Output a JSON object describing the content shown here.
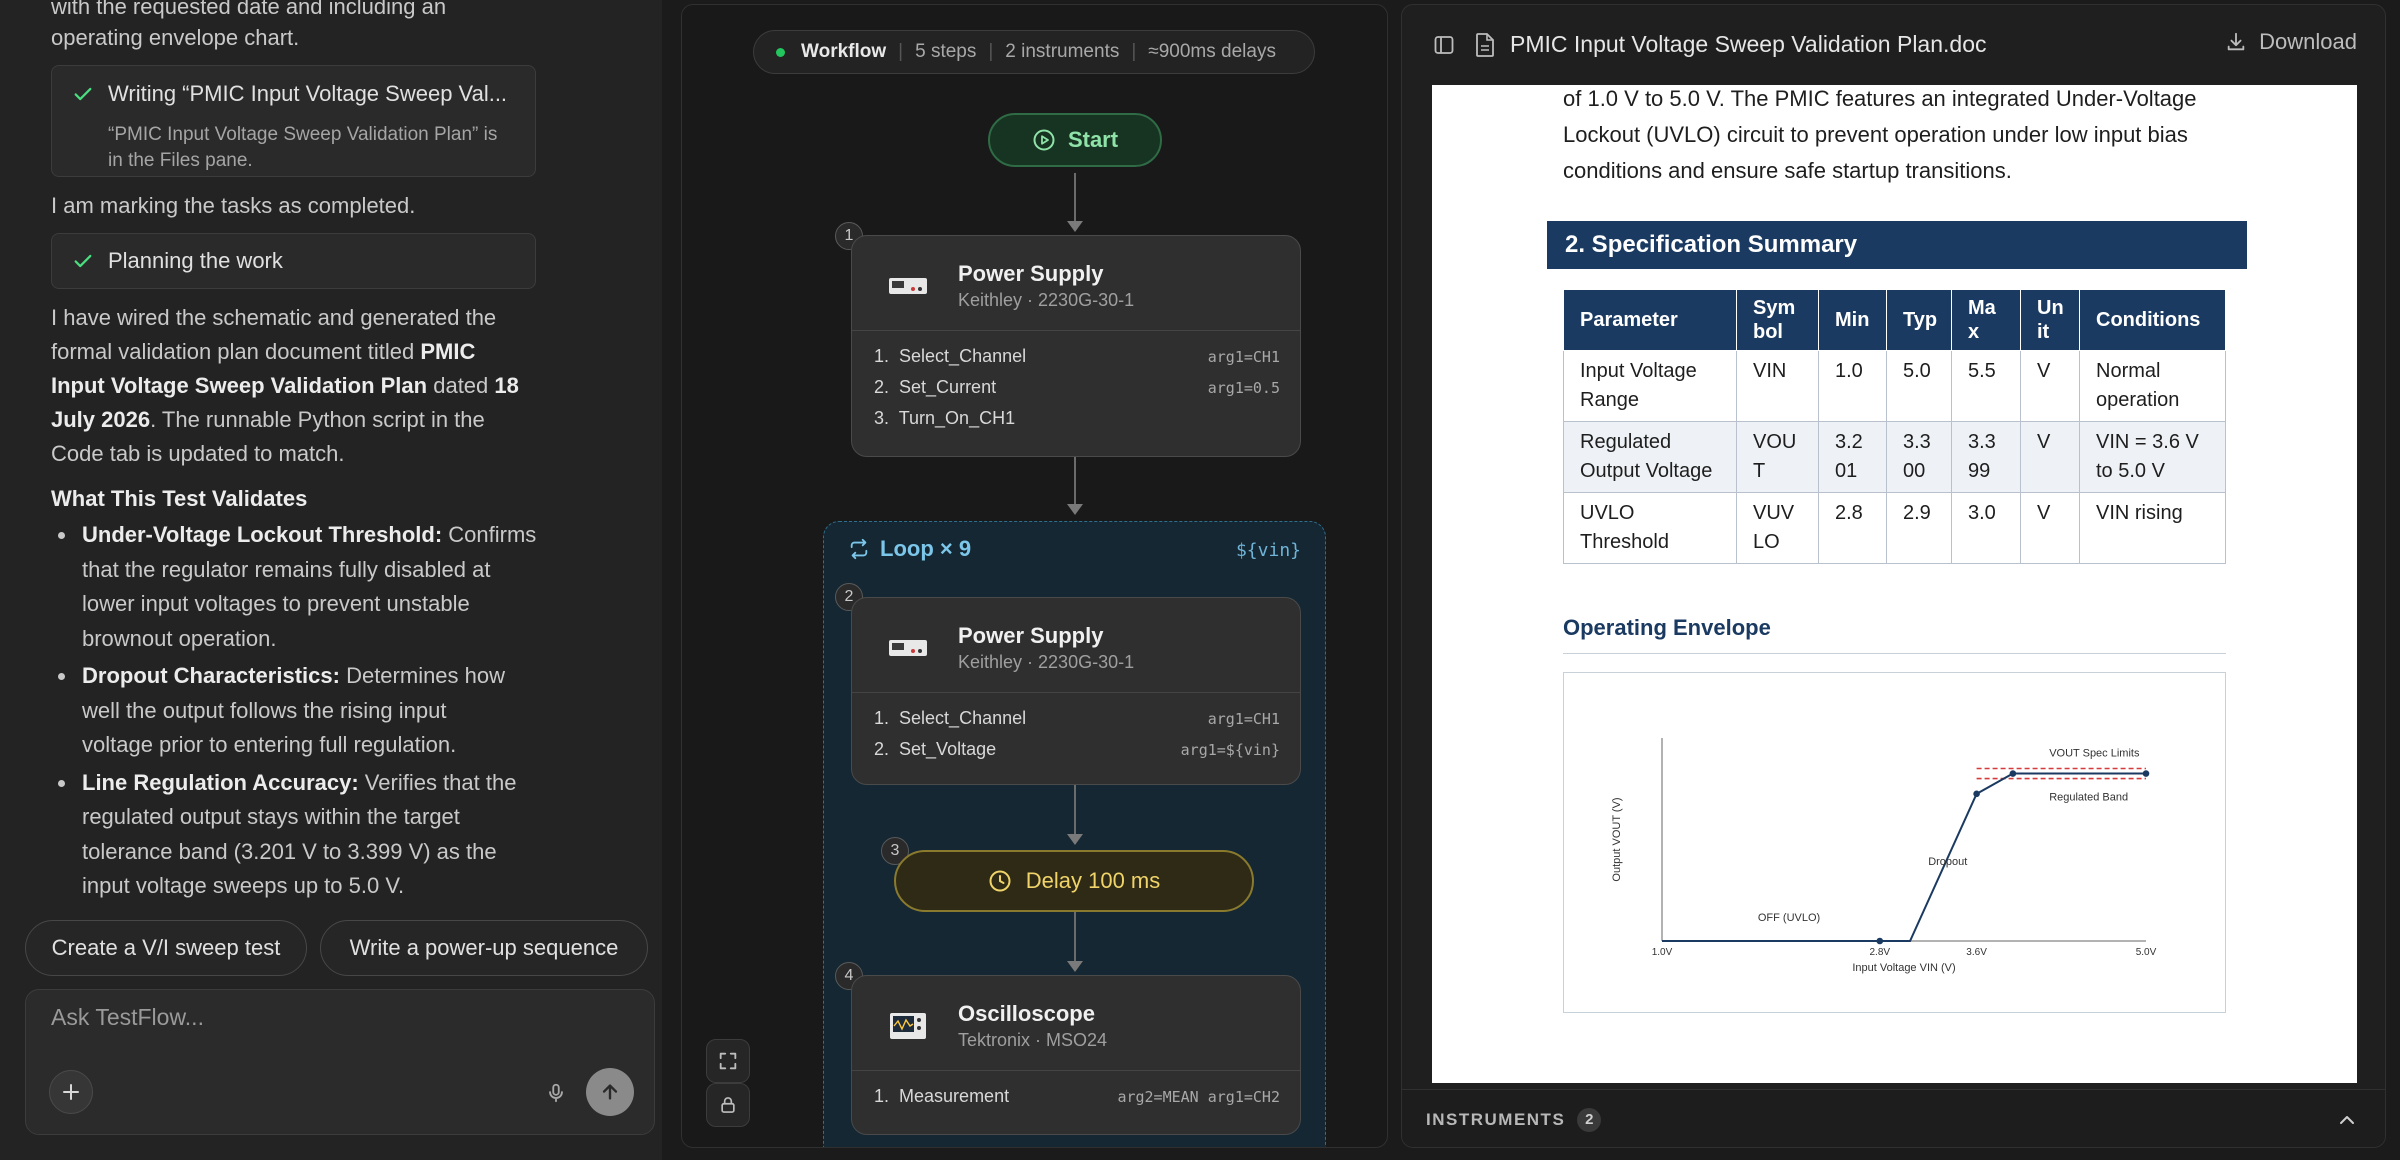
{
  "chat": {
    "intro_line1": "with the requested date and including an",
    "intro_line2": "operating envelope chart.",
    "task_writing": {
      "title": "Writing “PMIC Input Voltage Sweep Val...",
      "sub1": "“PMIC Input Voltage Sweep Validation Plan” is",
      "sub2": "in the Files pane."
    },
    "marking_text": "I am marking the tasks as completed.",
    "task_planning": {
      "title": "Planning the work"
    },
    "para": {
      "l1": "I have wired the schematic and generated the",
      "l2a": "formal validation plan document titled ",
      "l2b": "PMIC",
      "l3a": "Input Voltage Sweep Validation Plan",
      "l3b": " dated ",
      "l3c": "18",
      "l4a": "July 2026",
      "l4b": ". The runnable Python script in the",
      "l5": "Code tab is updated to match."
    },
    "validates_heading": "What This Test Validates",
    "bullets": [
      {
        "bold": "Under-Voltage Lockout Threshold:",
        "l1": " Confirms",
        "l2": "that the regulator remains fully disabled at",
        "l3": "lower input voltages to prevent unstable",
        "l4": "brownout operation."
      },
      {
        "bold": "Dropout Characteristics:",
        "l1": " Determines how",
        "l2": "well the output follows the rising input",
        "l3": "voltage prior to entering full regulation."
      },
      {
        "bold": "Line Regulation Accuracy:",
        "l1": " Verifies that the",
        "l2": "regulated output stays within the target",
        "l3": "tolerance band (3.201 V to 3.399 V) as the",
        "l4": "input voltage sweeps up to 5.0 V."
      }
    ],
    "suggestions": [
      "Create a V/I sweep test",
      "Write a power-up sequence"
    ],
    "composer_placeholder": "Ask TestFlow..."
  },
  "workflow": {
    "bar": {
      "label": "Workflow",
      "steps": "5 steps",
      "instruments": "2 instruments",
      "delays": "≈900ms delays"
    },
    "start_label": "Start",
    "node1": {
      "badge": "1",
      "title": "Power Supply",
      "subtitle": "Keithley · 2230G-30-1",
      "steps": [
        {
          "n": "1.",
          "name": "Select_Channel",
          "arg": "arg1=CH1"
        },
        {
          "n": "2.",
          "name": "Set_Current",
          "arg": "arg1=0.5"
        },
        {
          "n": "3.",
          "name": "Turn_On_CH1",
          "arg": ""
        }
      ]
    },
    "loop": {
      "label": "Loop × 9",
      "var": "${vin}"
    },
    "node2": {
      "badge": "2",
      "title": "Power Supply",
      "subtitle": "Keithley · 2230G-30-1",
      "steps": [
        {
          "n": "1.",
          "name": "Select_Channel",
          "arg": "arg1=CH1"
        },
        {
          "n": "2.",
          "name": "Set_Voltage",
          "arg": "arg1=${vin}"
        }
      ]
    },
    "delay": {
      "badge": "3",
      "label": "Delay 100 ms"
    },
    "node4": {
      "badge": "4",
      "title": "Oscilloscope",
      "subtitle": "Tektronix · MSO24",
      "steps": [
        {
          "n": "1.",
          "name": "Measurement",
          "arg": "arg2=MEAN arg1=CH2"
        }
      ]
    }
  },
  "document": {
    "filename": "PMIC Input Voltage Sweep Validation Plan.doc",
    "download_label": "Download",
    "intro_l1": "of 1.0 V to 5.0 V. The PMIC features an integrated Under-Voltage",
    "intro_l2": "Lockout (UVLO) circuit to prevent operation under low input bias",
    "intro_l3": "conditions and ensure safe startup transitions.",
    "section_title": "2. Specification Summary",
    "table": {
      "headers": [
        [
          "Parameter",
          ""
        ],
        [
          "Sym",
          "bol"
        ],
        [
          "Min",
          ""
        ],
        [
          "Typ",
          ""
        ],
        [
          "Ma",
          "x"
        ],
        [
          "Un",
          "it"
        ],
        [
          "Conditions",
          ""
        ]
      ],
      "rows": [
        [
          [
            "Input Voltage",
            "Range"
          ],
          [
            "VIN",
            ""
          ],
          [
            "1.0",
            ""
          ],
          [
            "5.0",
            ""
          ],
          [
            "5.5",
            ""
          ],
          [
            "V",
            ""
          ],
          [
            "Normal",
            "operation"
          ]
        ],
        [
          [
            "Regulated",
            "Output Voltage"
          ],
          [
            "VOU",
            "T"
          ],
          [
            "3.2",
            "01"
          ],
          [
            "3.3",
            "00"
          ],
          [
            "3.3",
            "99"
          ],
          [
            "V",
            ""
          ],
          [
            "VIN = 3.6 V",
            "to 5.0 V"
          ]
        ],
        [
          [
            "UVLO",
            "Threshold"
          ],
          [
            "VUV",
            "LO"
          ],
          [
            "2.8",
            ""
          ],
          [
            "2.9",
            ""
          ],
          [
            "3.0",
            ""
          ],
          [
            "V",
            ""
          ],
          [
            "VIN rising",
            ""
          ]
        ]
      ]
    },
    "envelope_heading": "Operating Envelope",
    "chart_data": {
      "type": "line",
      "xlabel": "Input Voltage VIN (V)",
      "ylabel": "Output VOUT (V)",
      "xticks": [
        "1.0V",
        "2.8V",
        "3.6V",
        "5.0V"
      ],
      "xlim": [
        1.0,
        5.0
      ],
      "ylim": [
        0,
        4.0
      ],
      "series": [
        {
          "x": [
            1.0,
            2.8,
            3.05,
            3.6,
            3.9,
            5.0
          ],
          "y": [
            0,
            0,
            0,
            2.9,
            3.3,
            3.3
          ]
        }
      ],
      "markers": [
        {
          "x": 2.8,
          "y": 0
        },
        {
          "x": 3.6,
          "y": 2.9
        },
        {
          "x": 3.9,
          "y": 3.3
        },
        {
          "x": 5.0,
          "y": 3.3
        }
      ],
      "limits": {
        "upper": 3.399,
        "lower": 3.201,
        "from": 3.6,
        "to": 5.0
      },
      "annotations": {
        "off": "OFF (UVLO)",
        "dropout": "Dropout",
        "spec": "VOUT Spec Limits",
        "band": "Regulated Band"
      },
      "colors": {
        "line": "#1b3a61",
        "limits": "#d43c3c"
      }
    },
    "footer_label": "INSTRUMENTS",
    "footer_count": "2"
  }
}
